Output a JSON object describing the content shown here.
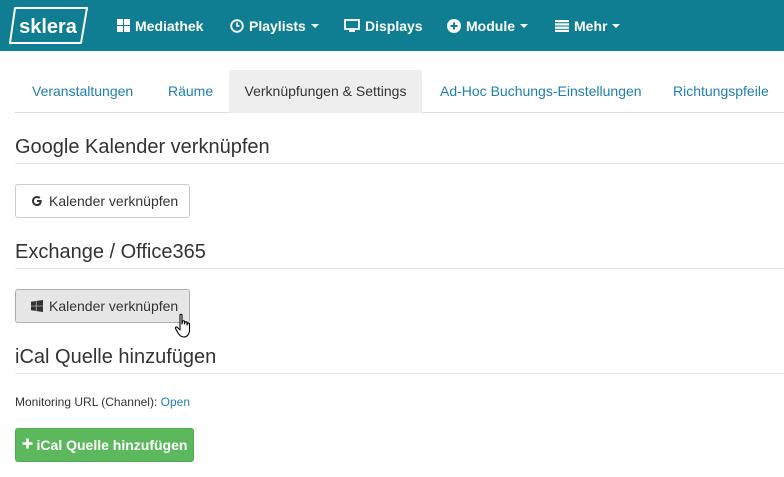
{
  "navbar": {
    "logo_text": "sklera",
    "items": [
      {
        "label": "Mediathek",
        "icon": "grid-icon"
      },
      {
        "label": "Playlists",
        "icon": "clock-icon",
        "dropdown": true
      },
      {
        "label": "Displays",
        "icon": "monitor-icon"
      },
      {
        "label": "Module",
        "icon": "plus-circle-icon",
        "dropdown": true
      },
      {
        "label": "Mehr",
        "icon": "list-icon",
        "dropdown": true
      }
    ],
    "color": "#0f7e93"
  },
  "tabs": [
    {
      "label": "Veranstaltungen"
    },
    {
      "label": "Räume"
    },
    {
      "label": "Verknüpfungen & Settings",
      "active": true
    },
    {
      "label": "Ad-Hoc Buchungs-Einstellungen"
    },
    {
      "label": "Richtungspfeile"
    }
  ],
  "sections": {
    "google": {
      "title": "Google Kalender verknüpfen",
      "button_label": "Kalender verknüpfen",
      "button_icon": "google-icon"
    },
    "exchange": {
      "title": "Exchange / Office365",
      "button_label": "Kalender verknüpfen",
      "button_icon": "windows-icon"
    },
    "ical": {
      "title": "iCal Quelle hinzufügen",
      "monitoring_label": "Monitoring URL (Channel):",
      "monitoring_link": "Open",
      "add_button_label": "iCal Quelle hinzufügen",
      "add_button_icon": "plus-icon"
    }
  },
  "colors": {
    "link": "#1f7fb3",
    "success": "#5cb85c"
  }
}
